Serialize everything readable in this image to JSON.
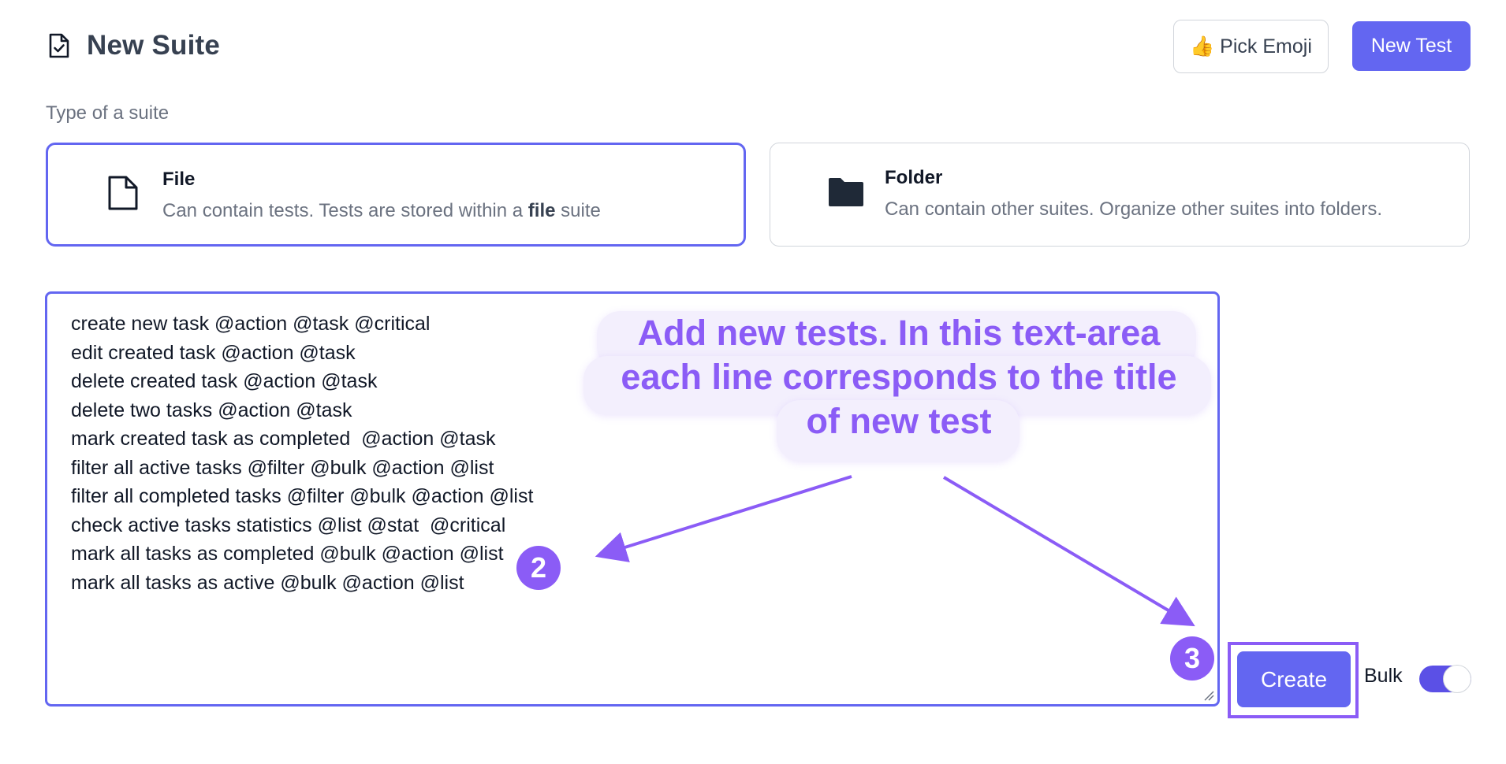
{
  "header": {
    "title": "New Suite",
    "pick_emoji_label": "👍 Pick Emoji",
    "new_test_label": "New Test"
  },
  "suite_type": {
    "label": "Type of a suite",
    "options": [
      {
        "title": "File",
        "desc_before": "Can contain tests. Tests are stored within a ",
        "desc_bold": "file",
        "desc_after": " suite",
        "selected": true
      },
      {
        "title": "Folder",
        "desc": "Can contain other suites. Organize other suites into folders.",
        "selected": false
      }
    ]
  },
  "tests_textarea": {
    "lines": [
      "create new task @action @task @critical",
      "edit created task @action @task",
      "delete created task @action @task",
      "delete two tasks @action @task",
      "mark created task as completed  @action @task",
      "filter all active tasks @filter @bulk @action @list",
      "filter all completed tasks @filter @bulk @action @list",
      "check active tasks statistics @list @stat  @critical",
      "mark all tasks as completed @bulk @action @list",
      "mark all tasks as active @bulk @action @list"
    ]
  },
  "annotation": {
    "callout_lines": [
      "Add new tests. In this text-area",
      "each line corresponds to the title",
      "of new test"
    ],
    "badge_2": "2",
    "badge_3": "3"
  },
  "footer": {
    "create_label": "Create",
    "bulk_label": "Bulk",
    "bulk_enabled": true
  },
  "colors": {
    "primary": "#6366f1",
    "annotation": "#8b5cf6"
  }
}
